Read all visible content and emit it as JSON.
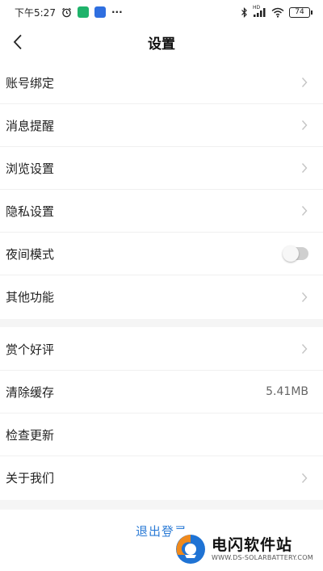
{
  "status_bar": {
    "time": "下午5:27",
    "more": "···",
    "network_type": "HD",
    "battery": "74",
    "icons": [
      "alarm-icon",
      "app-badge-green",
      "app-badge-blue",
      "bluetooth-icon",
      "signal-icon",
      "wifi-icon",
      "battery-icon"
    ]
  },
  "nav": {
    "title": "设置",
    "back_icon": "chevron-left-icon"
  },
  "group1": [
    {
      "label": "账号绑定",
      "type": "chevron"
    },
    {
      "label": "消息提醒",
      "type": "chevron"
    },
    {
      "label": "浏览设置",
      "type": "chevron"
    },
    {
      "label": "隐私设置",
      "type": "chevron"
    },
    {
      "label": "夜间模式",
      "type": "toggle",
      "toggle_on": false
    },
    {
      "label": "其他功能",
      "type": "chevron"
    }
  ],
  "group2": [
    {
      "label": "赏个好评",
      "type": "chevron"
    },
    {
      "label": "清除缓存",
      "type": "value",
      "value": "5.41MB"
    },
    {
      "label": "检查更新",
      "type": "none"
    },
    {
      "label": "关于我们",
      "type": "chevron"
    }
  ],
  "logout": {
    "label": "退出登录"
  },
  "watermark": {
    "name": "电闪软件站",
    "url": "WWW.DS-SOLARBATTERY.COM"
  },
  "colors": {
    "link_blue": "#2b7bd6",
    "divider": "#f0f0f0",
    "section_gap": "#f5f5f5",
    "chevron": "#c4c4c4",
    "logo_orange": "#f08a1c",
    "logo_blue": "#1f73d4"
  }
}
